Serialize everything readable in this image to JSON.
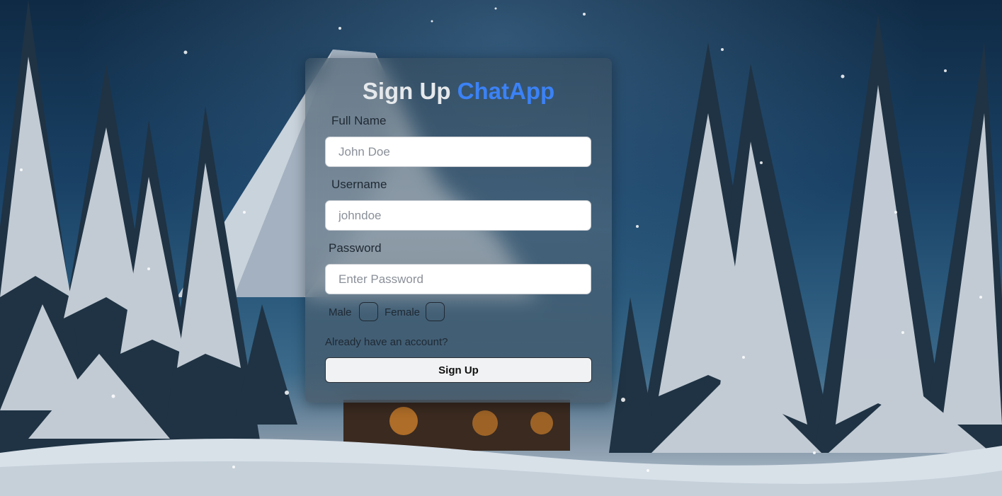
{
  "page": {
    "title_prefix": "Sign Up",
    "title_brand": "ChatApp",
    "brand_color": "#3b82f6"
  },
  "form": {
    "full_name": {
      "label": "Full Name",
      "placeholder": "John Doe",
      "value": ""
    },
    "username": {
      "label": "Username",
      "placeholder": "johndoe",
      "value": ""
    },
    "password": {
      "label": "Password",
      "placeholder": "Enter Password",
      "value": ""
    },
    "gender": {
      "male_label": "Male",
      "male_checked": false,
      "female_label": "Female",
      "female_checked": false
    },
    "login_link": "Already have an account?",
    "submit_label": "Sign Up"
  },
  "background": {
    "scene": "snowy-forest-mountain-night",
    "colors": {
      "sky": "#1a4266",
      "snow": "#dfe6ee",
      "tree": "#1c2d3a"
    }
  }
}
